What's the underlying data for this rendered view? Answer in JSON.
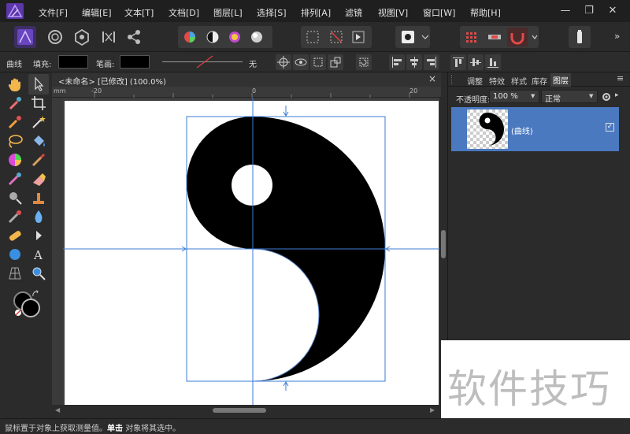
{
  "menu": {
    "items": [
      "文件[F]",
      "编辑[E]",
      "文本[T]",
      "文档[D]",
      "图层[L]",
      "选择[S]",
      "排列[A]",
      "滤镜",
      "视图[V]",
      "窗口[W]",
      "帮助[H]"
    ]
  },
  "window_controls": {
    "minimize": "—",
    "restore": "❐",
    "close": "✕"
  },
  "context_bar": {
    "curve_label": "曲线",
    "fill_label": "填充:",
    "stroke_label": "笔画:",
    "stroke_value": "无"
  },
  "document": {
    "title": "<未命名> [已修改] (100.0%)",
    "close_icon": "×",
    "ruler_labels": [
      "mm",
      "-20",
      "0",
      "20"
    ]
  },
  "panel": {
    "tabs": [
      "调整",
      "特效",
      "样式",
      "库存",
      "图层"
    ],
    "active_tab": "图层",
    "opacity_label": "不透明度:",
    "opacity_value": "100 %",
    "blend_mode": "正常",
    "layer_name": "(曲线)",
    "layer_checked": "✓"
  },
  "status": {
    "prefix": "鼠标置于对象上获取测量值。",
    "bold": "单击",
    "suffix": "对象将其选中。"
  },
  "watermark": {
    "text": "软件技巧"
  },
  "colors": {
    "accent": "#4a79c0",
    "brand_logo": "#7b4fc9",
    "guide": "#3b7bd6",
    "shape": "#000000"
  }
}
